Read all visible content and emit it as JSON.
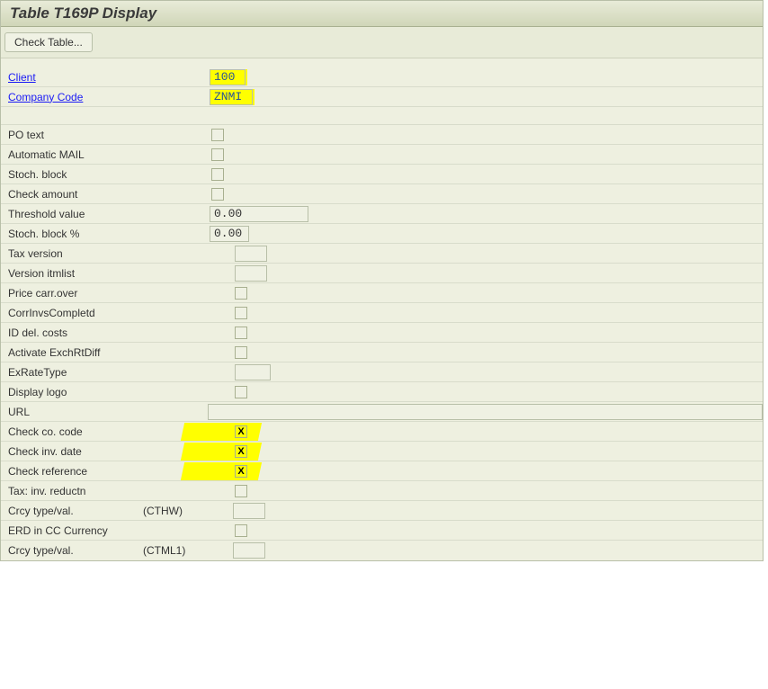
{
  "title": "Table T169P Display",
  "toolbar": {
    "check_table": "Check Table..."
  },
  "header": {
    "client_label": "Client",
    "client_value": "100",
    "company_code_label": "Company Code",
    "company_code_value": "ZNMI"
  },
  "fields": {
    "po_text": "PO text",
    "automatic_mail": "Automatic MAIL",
    "stoch_block": "Stoch. block",
    "check_amount": "Check amount",
    "threshold_value": "Threshold value",
    "threshold_value_val": "0.00",
    "stoch_block_pct": "Stoch. block  %",
    "stoch_block_pct_val": "0.00",
    "tax_version": "Tax version",
    "version_itemlist": "Version itmlist",
    "price_carr_over": "Price carr.over",
    "corr_invs_completd": "CorrInvsCompletd",
    "id_del_costs": "ID del. costs",
    "activate_exchrtdiff": "Activate ExchRtDiff",
    "ex_rate_type": "ExRateType",
    "display_logo": "Display logo",
    "url": "URL",
    "check_co_code": "Check co. code",
    "check_co_code_val": "X",
    "check_inv_date": "Check inv. date",
    "check_inv_date_val": "X",
    "check_reference": "Check reference",
    "check_reference_val": "X",
    "tax_inv_reductn": "Tax: inv. reductn",
    "crcy_type_val": "Crcy type/val.",
    "cthw": "(CTHW)",
    "erd_in_cc_currency": "ERD in CC Currency",
    "ctml1": "(CTML1)"
  }
}
